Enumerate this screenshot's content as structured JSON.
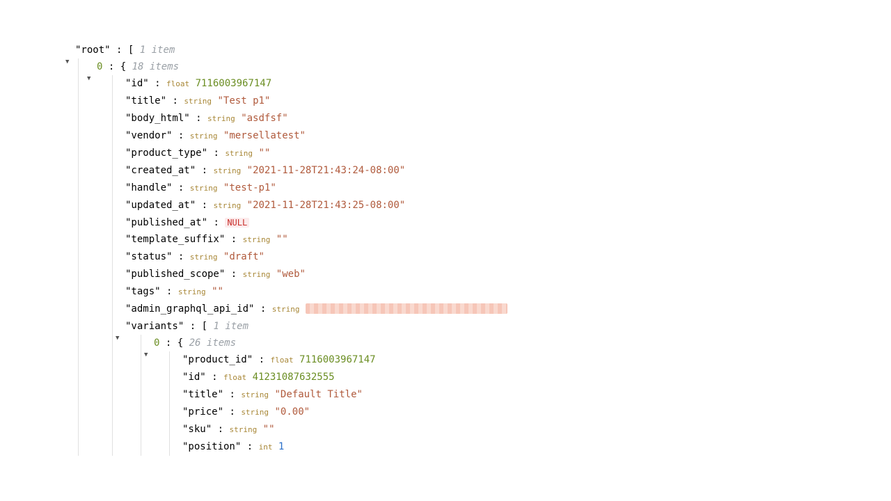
{
  "root": {
    "label": "\"root\"",
    "count": "1 item",
    "item0": {
      "idx": "0",
      "count": "18 items",
      "id": {
        "key": "\"id\"",
        "type": "float",
        "val": "7116003967147"
      },
      "title": {
        "key": "\"title\"",
        "type": "string",
        "val": "\"Test p1\""
      },
      "body_html": {
        "key": "\"body_html\"",
        "type": "string",
        "val": "\"asdfsf\""
      },
      "vendor": {
        "key": "\"vendor\"",
        "type": "string",
        "val": "\"mersellatest\""
      },
      "product_type": {
        "key": "\"product_type\"",
        "type": "string",
        "val": "\"\""
      },
      "created_at": {
        "key": "\"created_at\"",
        "type": "string",
        "val": "\"2021-11-28T21:43:24-08:00\""
      },
      "handle": {
        "key": "\"handle\"",
        "type": "string",
        "val": "\"test-p1\""
      },
      "updated_at": {
        "key": "\"updated_at\"",
        "type": "string",
        "val": "\"2021-11-28T21:43:25-08:00\""
      },
      "published_at": {
        "key": "\"published_at\"",
        "null": "NULL"
      },
      "template_suffix": {
        "key": "\"template_suffix\"",
        "type": "string",
        "val": "\"\""
      },
      "status": {
        "key": "\"status\"",
        "type": "string",
        "val": "\"draft\""
      },
      "published_scope": {
        "key": "\"published_scope\"",
        "type": "string",
        "val": "\"web\""
      },
      "tags": {
        "key": "\"tags\"",
        "type": "string",
        "val": "\"\""
      },
      "admin_graphql_api_id": {
        "key": "\"admin_graphql_api_id\"",
        "type": "string"
      },
      "variants": {
        "key": "\"variants\"",
        "count": "1 item",
        "item0": {
          "idx": "0",
          "count": "26 items",
          "product_id": {
            "key": "\"product_id\"",
            "type": "float",
            "val": "7116003967147"
          },
          "id": {
            "key": "\"id\"",
            "type": "float",
            "val": "41231087632555"
          },
          "title": {
            "key": "\"title\"",
            "type": "string",
            "val": "\"Default Title\""
          },
          "price": {
            "key": "\"price\"",
            "type": "string",
            "val": "\"0.00\""
          },
          "sku": {
            "key": "\"sku\"",
            "type": "string",
            "val": "\"\""
          },
          "position": {
            "key": "\"position\"",
            "type": "int",
            "val": "1"
          }
        }
      }
    }
  }
}
